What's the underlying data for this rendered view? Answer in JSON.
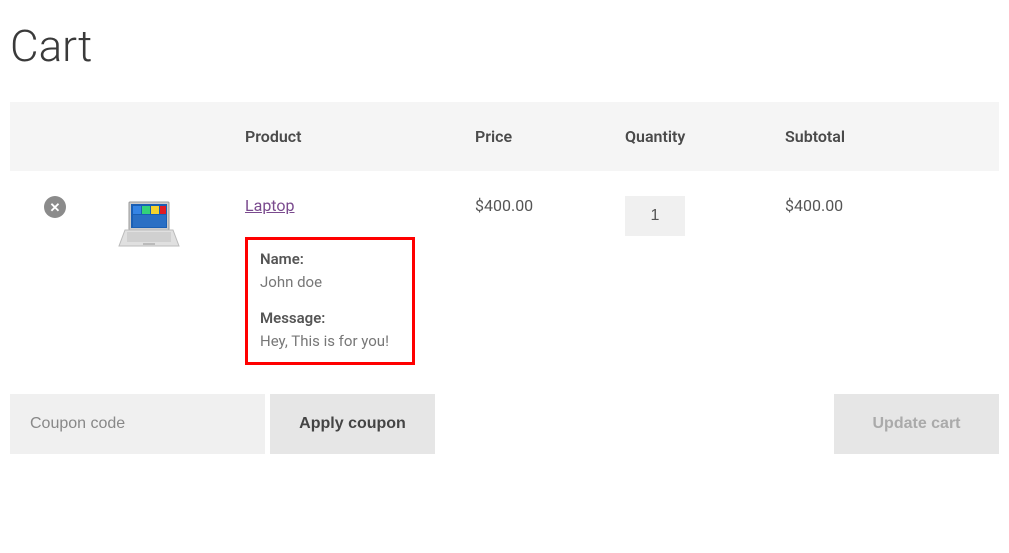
{
  "page_title": "Cart",
  "headers": {
    "product": "Product",
    "price": "Price",
    "quantity": "Quantity",
    "subtotal": "Subtotal"
  },
  "item": {
    "product_name": "Laptop",
    "price": "$400.00",
    "quantity": "1",
    "subtotal": "$400.00",
    "meta": {
      "name_label": "Name:",
      "name_value": "John doe",
      "message_label": "Message:",
      "message_value": "Hey, This is for you!"
    }
  },
  "actions": {
    "coupon_placeholder": "Coupon code",
    "apply_label": "Apply coupon",
    "update_label": "Update cart"
  }
}
